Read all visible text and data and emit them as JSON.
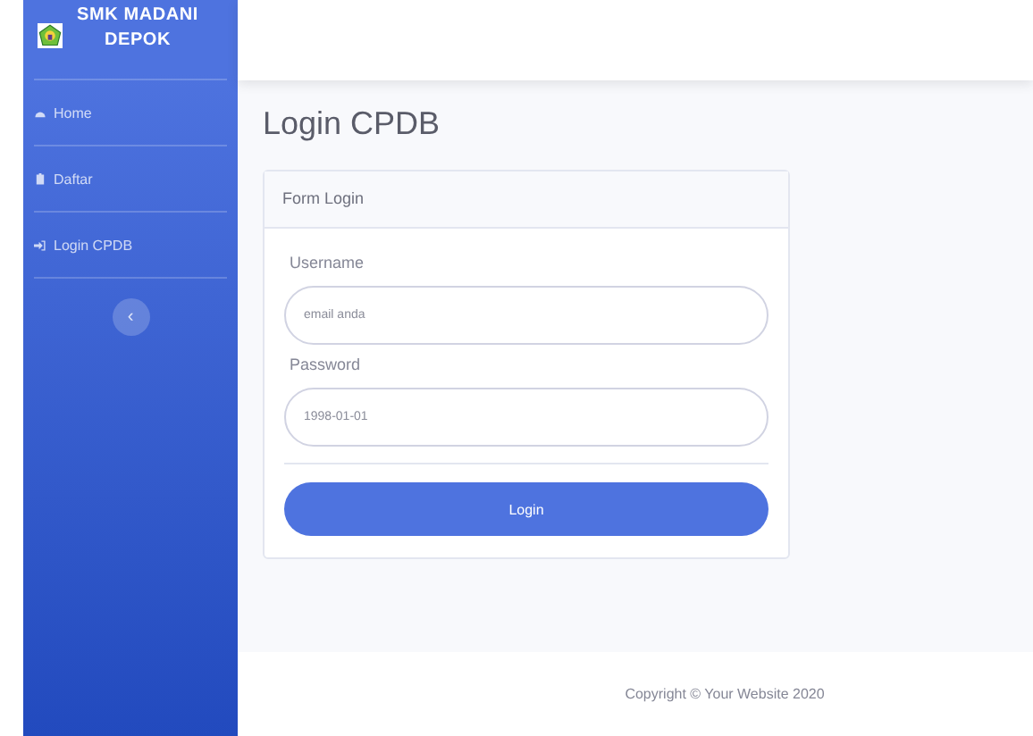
{
  "sidebar": {
    "brand": {
      "line1": "SMK MADANI",
      "line2": "DEPOK"
    },
    "items": [
      {
        "label": "Home"
      },
      {
        "label": "Daftar"
      },
      {
        "label": "Login CPDB"
      }
    ],
    "toggle": "‹"
  },
  "page_title": "Login CPDB",
  "card": {
    "header": "Form Login",
    "fields": [
      {
        "label": "Username",
        "placeholder": "email anda"
      },
      {
        "label": "Password",
        "placeholder": "1998-01-01"
      }
    ],
    "button": "Login"
  },
  "footer": "Copyright © Your Website 2020"
}
